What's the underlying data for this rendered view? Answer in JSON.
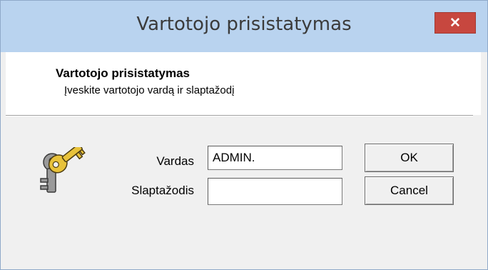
{
  "window": {
    "title": "Vartotojo prisistatymas",
    "close_glyph": "✕"
  },
  "header": {
    "title": "Vartotojo prisistatymas",
    "subtitle": "Įveskite vartotojo vardą ir slaptažodį"
  },
  "form": {
    "username_label": "Vardas",
    "username_value": "ADMIN.",
    "password_label": "Slaptažodis",
    "password_value": ""
  },
  "buttons": {
    "ok_label": "OK",
    "cancel_label": "Cancel"
  },
  "icon": {
    "name": "keys-icon"
  },
  "colors": {
    "titlebar": "#b9d3ef",
    "close_button": "#c7473f",
    "dialog_bg": "#f0f0f0"
  }
}
